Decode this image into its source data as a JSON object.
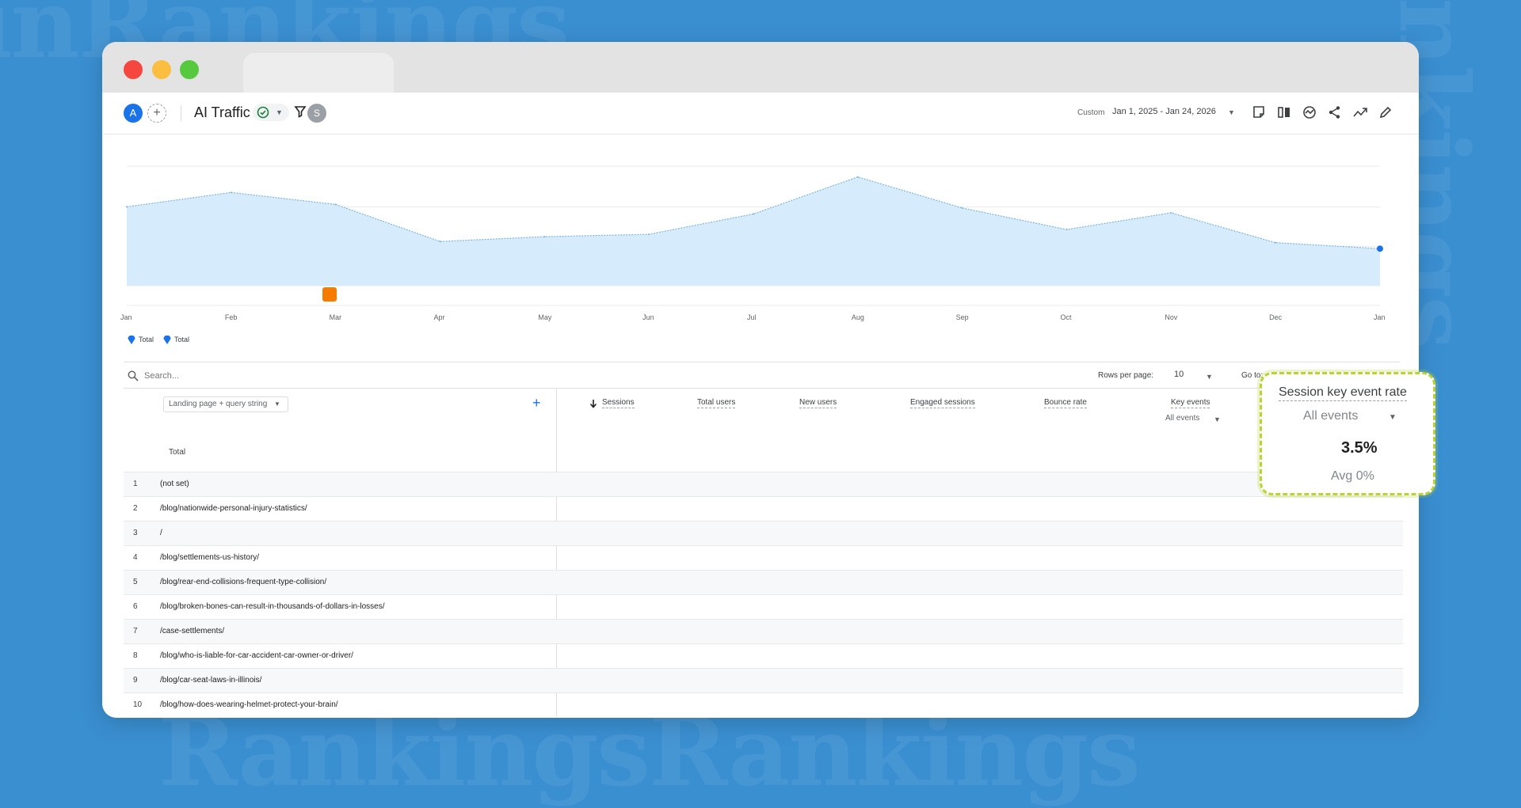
{
  "toolbar": {
    "avatar_letter": "A",
    "add_symbol": "+",
    "report_title": "AI Traffic",
    "segment_badge": "S",
    "custom_label": "Custom",
    "date_range": "Jan 1, 2025 - Jan 24, 2026"
  },
  "chart_data": {
    "type": "area",
    "x": [
      "Jan",
      "Feb",
      "Mar",
      "Apr",
      "May",
      "Jun",
      "Jul",
      "Aug",
      "Sep",
      "Oct",
      "Nov",
      "Dec",
      "Jan"
    ],
    "series": [
      {
        "name": "Total",
        "values": [
          0.66,
          0.78,
          0.68,
          0.37,
          0.41,
          0.43,
          0.6,
          0.91,
          0.65,
          0.47,
          0.61,
          0.36,
          0.31
        ]
      }
    ],
    "legend": [
      "Total",
      "Total"
    ],
    "grid": true,
    "legend_position": "bottom-left",
    "color": "#d6ebfb",
    "line_color": "#7fb5e0"
  },
  "search": {
    "placeholder": "Search..."
  },
  "pagination": {
    "rows_per_page_label": "Rows per page:",
    "rows_per_page_value": "10",
    "goto_label": "Go to:"
  },
  "table": {
    "dimension_select": "Landing page + query string",
    "add_symbol": "+",
    "total_label": "Total",
    "columns": [
      "Sessions",
      "Total users",
      "New users",
      "Engaged sessions",
      "Bounce rate",
      "Key events"
    ],
    "key_events_sub": "All events",
    "rows": [
      {
        "n": "1",
        "page": "(not set)"
      },
      {
        "n": "2",
        "page": "/blog/nationwide-personal-injury-statistics/"
      },
      {
        "n": "3",
        "page": "/"
      },
      {
        "n": "4",
        "page": "/blog/settlements-us-history/"
      },
      {
        "n": "5",
        "page": "/blog/rear-end-collisions-frequent-type-collision/"
      },
      {
        "n": "6",
        "page": "/blog/broken-bones-can-result-in-thousands-of-dollars-in-losses/"
      },
      {
        "n": "7",
        "page": "/case-settlements/"
      },
      {
        "n": "8",
        "page": "/blog/who-is-liable-for-car-accident-car-owner-or-driver/"
      },
      {
        "n": "9",
        "page": "/blog/car-seat-laws-in-illinois/"
      },
      {
        "n": "10",
        "page": "/blog/how-does-wearing-helmet-protect-your-brain/"
      }
    ]
  },
  "callout": {
    "title": "Session key event rate",
    "subtitle": "All events",
    "value": "3.5%",
    "average": "Avg 0%"
  },
  "colors": {
    "background": "#3a8fd1",
    "accent": "#1a73e8",
    "highlight": "#b8d433"
  }
}
